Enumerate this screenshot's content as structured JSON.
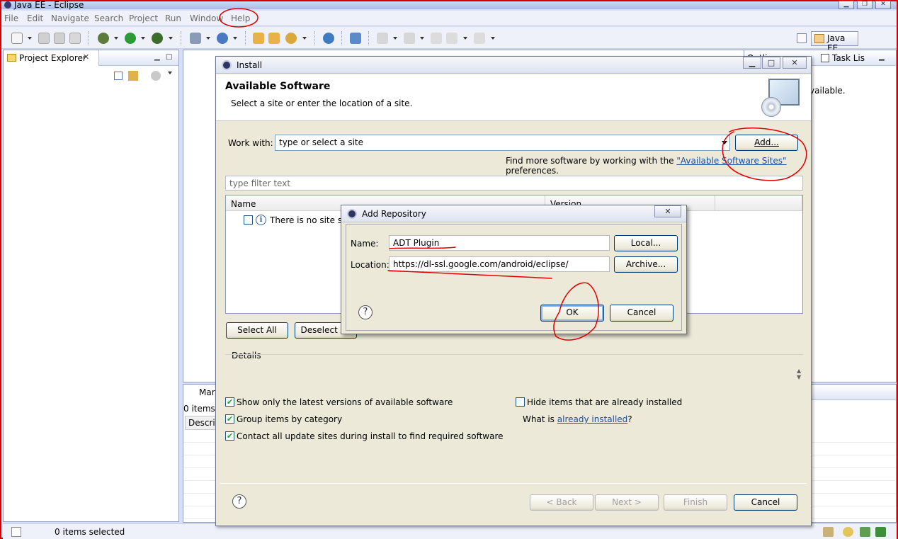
{
  "window": {
    "title": "Java EE - Eclipse"
  },
  "menu": [
    "File",
    "Edit",
    "Navigate",
    "Search",
    "Project",
    "Run",
    "Window",
    "Help"
  ],
  "perspective": {
    "label": "Java EE"
  },
  "project_explorer": {
    "tab_label": "Project Explorer"
  },
  "outline": {
    "tab1": "Outline",
    "tab2": "Task Lis",
    "message": "vailable."
  },
  "markers": {
    "tab_label": "Mark",
    "count": "0 items",
    "column": "Descript"
  },
  "status": {
    "text": "0 items selected"
  },
  "install": {
    "title": "Install",
    "heading": "Available Software",
    "subtitle": "Select a site or enter the location of a site.",
    "work_with_label": "Work with:",
    "work_with_value": "type or select a site",
    "add_button": "Add...",
    "find_more_prefix": "Find more software by working with the ",
    "find_more_link": "\"Available Software Sites\"",
    "find_more_suffix": " preferences.",
    "filter_placeholder": "type filter text",
    "columns": [
      "Name",
      "Version"
    ],
    "empty_row": "There is no site selected.",
    "select_all": "Select All",
    "deselect_all": "Deselect All",
    "details_label": "Details",
    "options": {
      "latest_versions": "Show only the latest versions of available software",
      "group_by_category": "Group items by category",
      "contact_sites": "Contact all update sites during install to find required software",
      "hide_installed": "Hide items that are already installed",
      "what_is": "What is ",
      "already_installed": "already installed",
      "what_is_suffix": "?"
    },
    "checks": {
      "latest_versions": true,
      "group_by_category": true,
      "contact_sites": true,
      "hide_installed": false
    },
    "back_button": "< Back",
    "next_button": "Next >",
    "finish_button": "Finish",
    "cancel_button": "Cancel"
  },
  "add_repository": {
    "title": "Add Repository",
    "name_label": "Name:",
    "name_value": "ADT Plugin",
    "location_label": "Location:",
    "location_value": "https://dl-ssl.google.com/android/eclipse/",
    "local_button": "Local...",
    "archive_button": "Archive...",
    "ok_button": "OK",
    "cancel_button": "Cancel"
  },
  "colors": {
    "annotation": "#e00000",
    "link": "#1a4fa3",
    "dialog_bg": "#ece9d8"
  }
}
